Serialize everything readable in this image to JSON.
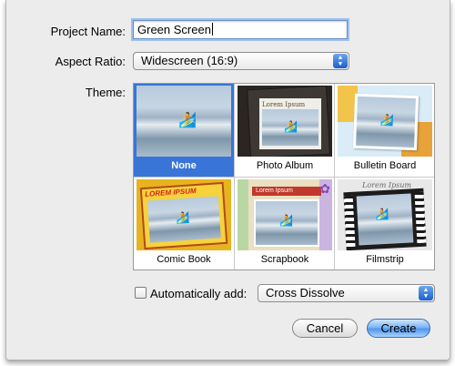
{
  "form": {
    "project_name_label": "Project Name:",
    "project_name_value": "Green Screen",
    "aspect_ratio_label": "Aspect Ratio:",
    "aspect_ratio_value": "Widescreen (16:9)",
    "theme_label": "Theme:"
  },
  "themes": [
    {
      "label": "None",
      "selected": true
    },
    {
      "label": "Photo Album",
      "selected": false
    },
    {
      "label": "Bulletin Board",
      "selected": false
    },
    {
      "label": "Comic Book",
      "selected": false
    },
    {
      "label": "Scrapbook",
      "selected": false
    },
    {
      "label": "Filmstrip",
      "selected": false
    }
  ],
  "theme_art": {
    "photo_album_text": "Lorem Ipsum",
    "comic_book_text": "LOREM IPSUM",
    "scrapbook_text": "Lorem Ipsum",
    "filmstrip_text": "Lorem Ipsum"
  },
  "auto_add": {
    "label": "Automatically add:",
    "checked": false,
    "value": "Cross Dissolve"
  },
  "buttons": {
    "cancel": "Cancel",
    "create": "Create"
  },
  "colors": {
    "selection": "#3875d7",
    "default_button": "#5197ea"
  }
}
